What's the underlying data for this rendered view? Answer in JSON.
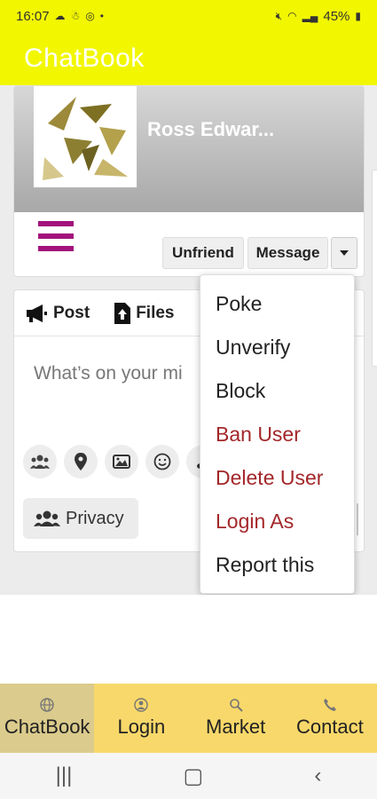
{
  "status_bar": {
    "time": "16:07",
    "battery": "45%"
  },
  "app": {
    "title": "ChatBook"
  },
  "profile": {
    "name": "Ross Edwar..."
  },
  "profile_actions": {
    "unfriend": "Unfriend",
    "message": "Message"
  },
  "post_box": {
    "tabs": [
      {
        "label": "Post",
        "icon": "megaphone-icon"
      },
      {
        "label": "Files",
        "icon": "file-upload-icon"
      }
    ],
    "placeholder": "What’s on your mi",
    "privacy_label": "Privacy"
  },
  "dropdown": {
    "items": [
      {
        "label": "Poke",
        "danger": false
      },
      {
        "label": "Unverify",
        "danger": false
      },
      {
        "label": "Block",
        "danger": false
      },
      {
        "label": "Ban User",
        "danger": true
      },
      {
        "label": "Delete User",
        "danger": true
      },
      {
        "label": "Login As",
        "danger": true
      },
      {
        "label": "Report this",
        "danger": false
      }
    ]
  },
  "bottom_nav": {
    "items": [
      {
        "label": "ChatBook",
        "icon": "globe-icon",
        "active": true
      },
      {
        "label": "Login",
        "icon": "user-circle-icon",
        "active": false
      },
      {
        "label": "Market",
        "icon": "search-icon",
        "active": false
      },
      {
        "label": "Contact",
        "icon": "phone-icon",
        "active": false
      }
    ]
  },
  "colors": {
    "brand_yellow": "#f2f700",
    "accent_purple": "#a3127c",
    "danger_red": "#a3272a",
    "nav_yellow": "#f8d86a"
  }
}
